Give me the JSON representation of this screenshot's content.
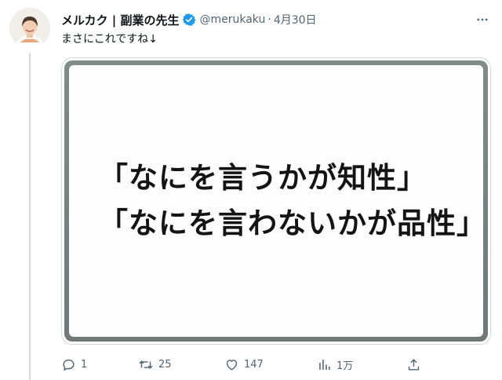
{
  "author": {
    "name": "メルカク | 副業の先生",
    "handle": "@merukaku",
    "separator": "·",
    "date": "4月30日",
    "avatar_icon": "avatar-photo",
    "verified_icon": "verified-badge-icon"
  },
  "tweet": {
    "text": "まさにこれですね↓"
  },
  "media": {
    "lines": [
      "「なにを言うかが知性」",
      "「なにを言わないかが品性」"
    ]
  },
  "actions": {
    "reply": {
      "icon": "reply-icon",
      "count": "1"
    },
    "retweet": {
      "icon": "retweet-icon",
      "count": "25"
    },
    "like": {
      "icon": "heart-icon",
      "count": "147"
    },
    "views": {
      "icon": "views-icon",
      "count": "1万"
    },
    "share": {
      "icon": "share-icon"
    }
  },
  "colors": {
    "text": "#0f1419",
    "secondary": "#536471",
    "verified": "#1d9bf0",
    "border": "#cfd9de"
  }
}
